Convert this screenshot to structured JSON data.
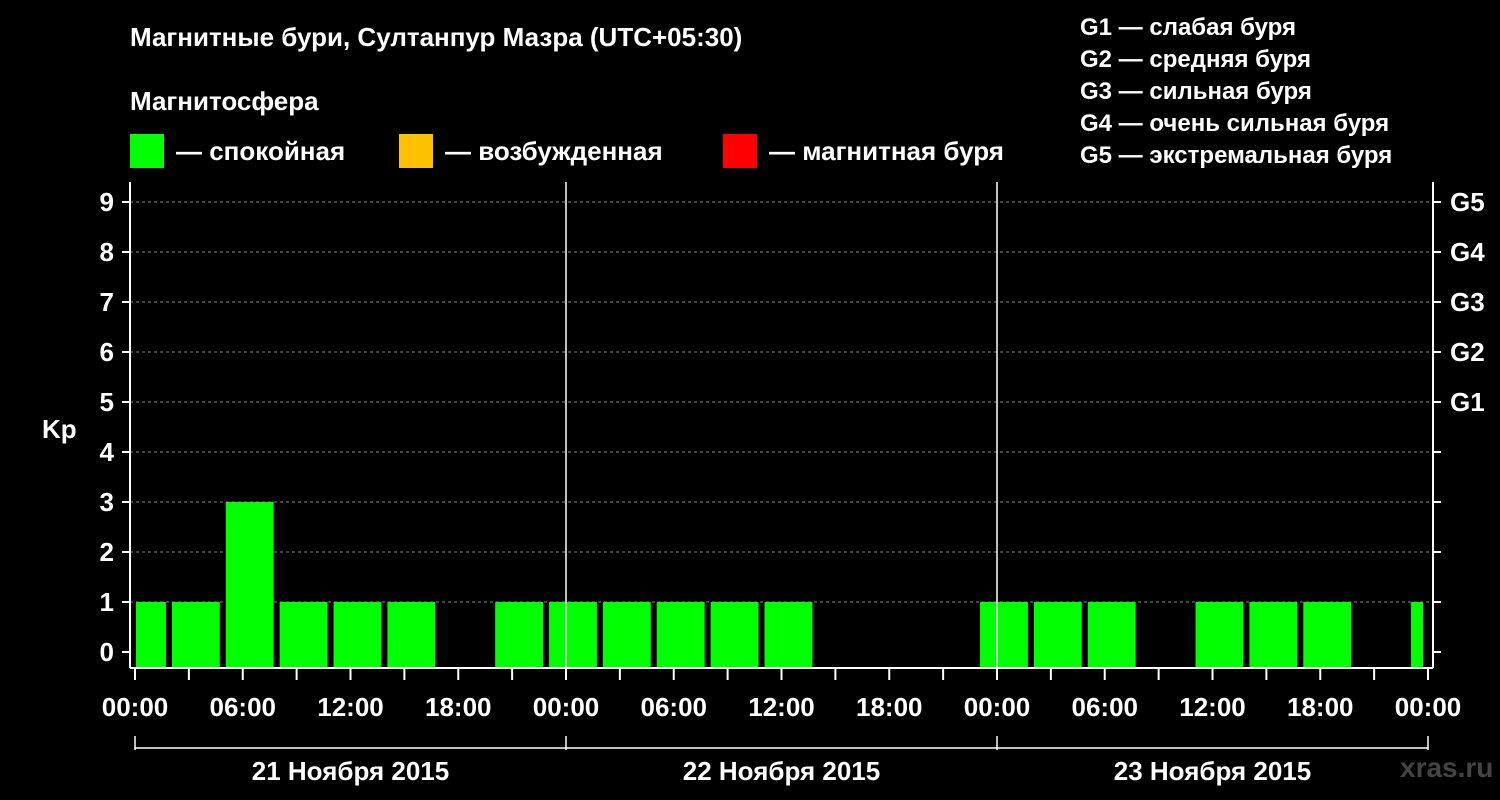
{
  "title": "Магнитные бури, Султанпур Мазра (UTC+05:30)",
  "magnetosphere": {
    "title": "Магнитосфера",
    "legend": [
      {
        "label": "— спокойная",
        "color": "#00ff00"
      },
      {
        "label": "— возбужденная",
        "color": "#ffc000"
      },
      {
        "label": "— магнитная буря",
        "color": "#ff0000"
      }
    ]
  },
  "g_legend": [
    "G1 — слабая буря",
    "G2 — средняя буря",
    "G3 — сильная буря",
    "G4 — очень сильная буря",
    "G5 — экстремальная буря"
  ],
  "watermark": "xras.ru",
  "chart_data": {
    "type": "bar",
    "ylabel": "Kp",
    "ylim": [
      0,
      9
    ],
    "yticks": [
      0,
      1,
      2,
      3,
      4,
      5,
      6,
      7,
      8,
      9
    ],
    "right_ticks": [
      {
        "kp": 5,
        "label": "G1"
      },
      {
        "kp": 6,
        "label": "G2"
      },
      {
        "kp": 7,
        "label": "G3"
      },
      {
        "kp": 8,
        "label": "G4"
      },
      {
        "kp": 9,
        "label": "G5"
      }
    ],
    "x_tick_labels": [
      "00:00",
      "06:00",
      "12:00",
      "18:00",
      "00:00",
      "06:00",
      "12:00",
      "18:00",
      "00:00",
      "06:00",
      "12:00",
      "18:00",
      "00:00"
    ],
    "days": [
      "21 Ноября 2015",
      "22 Ноября 2015",
      "23 Ноября 2015"
    ],
    "grid": true,
    "bars": [
      {
        "start": "21 Ноября 2015 00:00",
        "end": "21 Ноября 2015 02:00",
        "kp": 1,
        "level": "спокойная"
      },
      {
        "start": "21 Ноября 2015 02:00",
        "end": "21 Ноября 2015 05:00",
        "kp": 1,
        "level": "спокойная"
      },
      {
        "start": "21 Ноября 2015 05:00",
        "end": "21 Ноября 2015 08:00",
        "kp": 3,
        "level": "спокойная"
      },
      {
        "start": "21 Ноября 2015 08:00",
        "end": "21 Ноября 2015 11:00",
        "kp": 1,
        "level": "спокойная"
      },
      {
        "start": "21 Ноября 2015 11:00",
        "end": "21 Ноября 2015 14:00",
        "kp": 1,
        "level": "спокойная"
      },
      {
        "start": "21 Ноября 2015 14:00",
        "end": "21 Ноября 2015 17:00",
        "kp": 1,
        "level": "спокойная"
      },
      {
        "start": "21 Ноября 2015 20:00",
        "end": "21 Ноября 2015 23:00",
        "kp": 1,
        "level": "спокойная"
      },
      {
        "start": "21 Ноября 2015 23:00",
        "end": "22 Ноября 2015 02:00",
        "kp": 1,
        "level": "спокойная"
      },
      {
        "start": "22 Ноября 2015 02:00",
        "end": "22 Ноября 2015 05:00",
        "kp": 1,
        "level": "спокойная"
      },
      {
        "start": "22 Ноября 2015 05:00",
        "end": "22 Ноября 2015 08:00",
        "kp": 1,
        "level": "спокойная"
      },
      {
        "start": "22 Ноября 2015 08:00",
        "end": "22 Ноября 2015 11:00",
        "kp": 1,
        "level": "спокойная"
      },
      {
        "start": "22 Ноября 2015 11:00",
        "end": "22 Ноября 2015 14:00",
        "kp": 1,
        "level": "спокойная"
      },
      {
        "start": "22 Ноября 2015 23:00",
        "end": "23 Ноября 2015 02:00",
        "kp": 1,
        "level": "спокойная"
      },
      {
        "start": "23 Ноября 2015 02:00",
        "end": "23 Ноября 2015 05:00",
        "kp": 1,
        "level": "спокойная"
      },
      {
        "start": "23 Ноября 2015 05:00",
        "end": "23 Ноября 2015 08:00",
        "kp": 1,
        "level": "спокойная"
      },
      {
        "start": "23 Ноября 2015 11:00",
        "end": "23 Ноября 2015 14:00",
        "kp": 1,
        "level": "спокойная"
      },
      {
        "start": "23 Ноября 2015 14:00",
        "end": "23 Ноября 2015 17:00",
        "kp": 1,
        "level": "спокойная"
      },
      {
        "start": "23 Ноября 2015 17:00",
        "end": "23 Ноября 2015 20:00",
        "kp": 1,
        "level": "спокойная"
      },
      {
        "start": "23 Ноября 2015 23:00",
        "end": "24 Ноября 2015 00:00",
        "kp": 1,
        "level": "спокойная"
      }
    ]
  }
}
